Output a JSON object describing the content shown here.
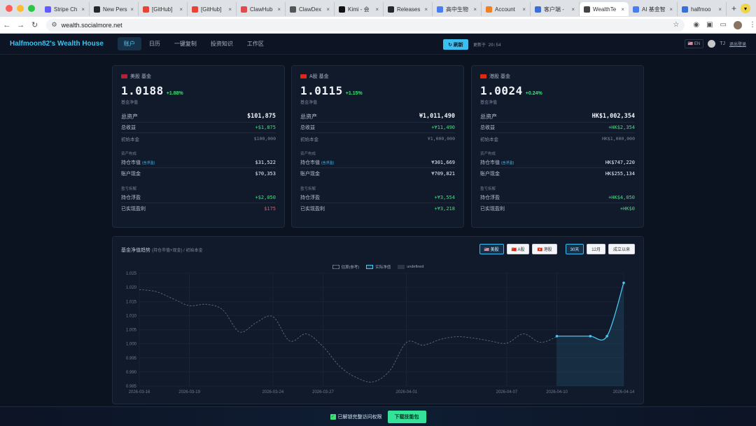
{
  "browser": {
    "tabs": [
      {
        "title": "Stripe Ch",
        "color": "#635bff",
        "active": false
      },
      {
        "title": "New Pers",
        "color": "#24292f",
        "active": false
      },
      {
        "title": "[GitHub]",
        "color": "#ea4335",
        "active": false
      },
      {
        "title": "[GitHub]",
        "color": "#ea4335",
        "active": false
      },
      {
        "title": "ClawHub",
        "color": "#e04b4b",
        "active": false
      },
      {
        "title": "ClawDex",
        "color": "#555555",
        "active": false
      },
      {
        "title": "Kimi - 会",
        "color": "#111111",
        "active": false
      },
      {
        "title": "Releases",
        "color": "#24292f",
        "active": false
      },
      {
        "title": "高中生物",
        "color": "#4a7df0",
        "active": false
      },
      {
        "title": "Account",
        "color": "#f38020",
        "active": false
      },
      {
        "title": "客户端 -",
        "color": "#3b6fd8",
        "active": false
      },
      {
        "title": "WealthTe",
        "color": "#444444",
        "active": true
      },
      {
        "title": "AI 基金智",
        "color": "#4a7df0",
        "active": false
      },
      {
        "title": "halfmoo",
        "color": "#3b6fd8",
        "active": false
      }
    ],
    "new_tab": "+",
    "url": "wealth.socialmore.net",
    "user_initial": "G"
  },
  "app": {
    "brand": "Halfmoon82's Wealth House",
    "nav": [
      {
        "label": "账户",
        "active": true
      },
      {
        "label": "日历",
        "active": false
      },
      {
        "label": "一键复制",
        "active": false
      },
      {
        "label": "投资知识",
        "active": false
      },
      {
        "label": "工作区",
        "active": false
      }
    ],
    "refresh_label": "↻ 刷新",
    "updated_text": "更新于 20:54",
    "lang": "🇺🇸 EN",
    "user": "TJ",
    "logout": "退出登录"
  },
  "cards": [
    {
      "title": "美股 基金",
      "flag_color": "#b22234",
      "nav": "1.0188",
      "change": "+1.88%",
      "nav_label": "基金净值",
      "total_assets_label": "总资产",
      "total_assets": "$101,875",
      "total_gain_label": "总收益",
      "total_gain": "+$1,875",
      "initial_label": "初始本金",
      "initial": "$100,000",
      "comp_label": "资产构成",
      "holding_label": "持仓市值",
      "holding_tag": "(含浮盈)",
      "holding": "$31,522",
      "cash_label": "账户现金",
      "cash": "$70,353",
      "pnl_label": "盈亏拆解",
      "float_label": "持仓浮盈",
      "float": "+$2,050",
      "realized_label": "已实现盈利",
      "realized": "$175",
      "realized_negative": true
    },
    {
      "title": "A股 基金",
      "flag_color": "#de2910",
      "nav": "1.0115",
      "change": "+1.15%",
      "nav_label": "基金净值",
      "total_assets_label": "总资产",
      "total_assets": "¥1,011,490",
      "total_gain_label": "总收益",
      "total_gain": "+¥11,490",
      "initial_label": "初始本金",
      "initial": "¥1,000,000",
      "comp_label": "资产构成",
      "holding_label": "持仓市值",
      "holding_tag": "(含浮盈)",
      "holding": "¥301,669",
      "cash_label": "账户现金",
      "cash": "¥709,821",
      "pnl_label": "盈亏拆解",
      "float_label": "持仓浮盈",
      "float": "+¥3,554",
      "realized_label": "已实现盈利",
      "realized": "+¥3,218",
      "realized_negative": false
    },
    {
      "title": "港股 基金",
      "flag_color": "#de2910",
      "nav": "1.0024",
      "change": "+0.24%",
      "nav_label": "基金净值",
      "total_assets_label": "总资产",
      "total_assets": "HK$1,002,354",
      "total_gain_label": "总收益",
      "total_gain": "+HK$2,354",
      "initial_label": "初始本金",
      "initial": "HK$1,000,000",
      "comp_label": "资产构成",
      "holding_label": "持仓市值",
      "holding_tag": "(含浮盈)",
      "holding": "HK$747,220",
      "cash_label": "账户现金",
      "cash": "HK$255,134",
      "pnl_label": "盈亏拆解",
      "float_label": "持仓浮盈",
      "float": "+HK$4,050",
      "realized_label": "已实现盈利",
      "realized": "+HK$0",
      "realized_negative": false
    }
  ],
  "chart_section": {
    "title": "基金净值趋势",
    "subtitle": "(持仓市值+现金) / 初始本金",
    "market_buttons": [
      {
        "label": "🇺🇸 美股",
        "selected": true
      },
      {
        "label": "🇨🇳 A股",
        "selected": false
      },
      {
        "label": "🇭🇰 港股",
        "selected": false
      }
    ],
    "range_buttons": [
      {
        "label": "30天",
        "selected": true
      },
      {
        "label": "12月",
        "selected": false
      },
      {
        "label": "成立以来",
        "selected": false
      }
    ]
  },
  "chart_data": {
    "type": "line",
    "legend": [
      "估算(参考)",
      "实际净值",
      "undefined"
    ],
    "ylim": [
      0.985,
      1.025
    ],
    "yticks": [
      "1.025",
      "1.020",
      "1.015",
      "1.010",
      "1.005",
      "1.000",
      "0.995",
      "0.990",
      "0.985"
    ],
    "xlim": [
      "2026-03-16",
      "2026-04-14"
    ],
    "xticks": [
      "2026-03-16",
      "2026-03-19",
      "2026-03-24",
      "2026-03-27",
      "2026-04-01",
      "2026-04-07",
      "2026-04-10",
      "2026-04-14"
    ],
    "grid": true,
    "series": [
      {
        "name": "估算(参考)",
        "style": "dashed",
        "color": "#5d6a80",
        "points": [
          [
            "2026-03-16",
            1.0192
          ],
          [
            "2026-03-17",
            1.0185
          ],
          [
            "2026-03-18",
            1.016
          ],
          [
            "2026-03-19",
            1.0135
          ],
          [
            "2026-03-20",
            1.014
          ],
          [
            "2026-03-21",
            1.012
          ],
          [
            "2026-03-22",
            1.0042
          ],
          [
            "2026-03-23",
            1.0075
          ],
          [
            "2026-03-24",
            1.0096
          ],
          [
            "2026-03-25",
            1.001
          ],
          [
            "2026-03-26",
            1.0035
          ],
          [
            "2026-03-27",
            0.999
          ],
          [
            "2026-03-28",
            0.992
          ],
          [
            "2026-03-29",
            0.988
          ],
          [
            "2026-03-30",
            0.9865
          ],
          [
            "2026-03-31",
            0.9905
          ],
          [
            "2026-04-01",
            1.0005
          ],
          [
            "2026-04-02",
            0.9995
          ],
          [
            "2026-04-03",
            1.0015
          ],
          [
            "2026-04-04",
            1.0025
          ],
          [
            "2026-04-05",
            1.002
          ],
          [
            "2026-04-06",
            1.001
          ],
          [
            "2026-04-07",
            1.0002
          ],
          [
            "2026-04-08",
            1.0035
          ],
          [
            "2026-04-09",
            1.0005
          ],
          [
            "2026-04-10",
            1.0025
          ]
        ]
      },
      {
        "name": "实际净值",
        "style": "solid",
        "color": "#4cc6f2",
        "fill": true,
        "points": [
          [
            "2026-04-10",
            1.0027
          ],
          [
            "2026-04-11",
            1.0027
          ],
          [
            "2026-04-12",
            1.0027
          ],
          [
            "2026-04-13",
            1.0027
          ],
          [
            "2026-04-14",
            1.0216
          ]
        ]
      }
    ]
  },
  "bottom": {
    "unlock_text": "已解锁完整访问权限",
    "download_label": "下载技能包"
  }
}
